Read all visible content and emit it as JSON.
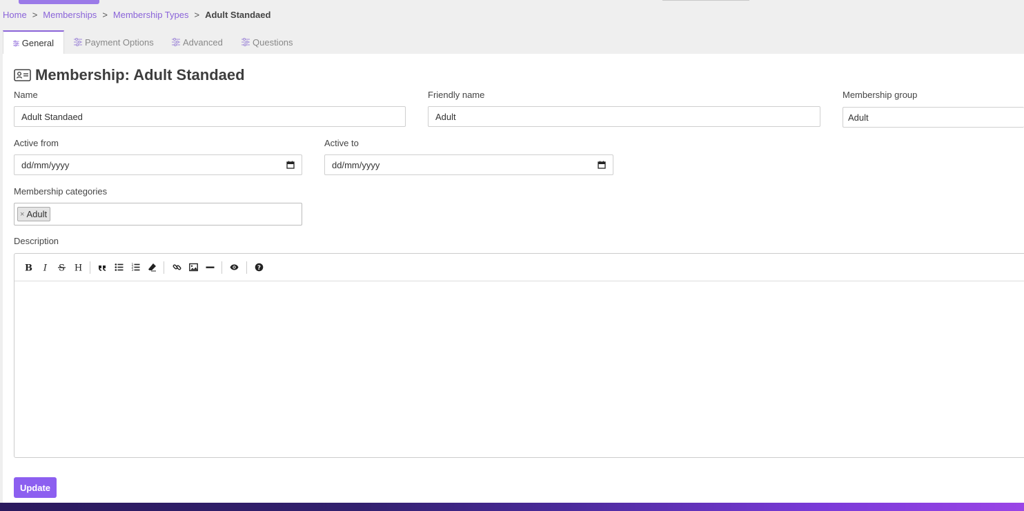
{
  "breadcrumb": {
    "items": [
      "Home",
      "Memberships",
      "Membership Types"
    ],
    "current": "Adult Standaed",
    "separator": ">"
  },
  "tabs": [
    {
      "label": "General",
      "icon": "sliders-icon",
      "active": true
    },
    {
      "label": "Payment Options",
      "icon": "sliders-icon",
      "active": false
    },
    {
      "label": "Advanced",
      "icon": "sliders-icon",
      "active": false
    },
    {
      "label": "Questions",
      "icon": "sliders-icon",
      "active": false
    }
  ],
  "page": {
    "title": "Membership: Adult Standaed",
    "title_icon": "id-card-icon"
  },
  "form": {
    "name": {
      "label": "Name",
      "value": "Adult Standaed"
    },
    "friendly_name": {
      "label": "Friendly name",
      "value": "Adult"
    },
    "membership_group": {
      "label": "Membership group",
      "value": "Adult"
    },
    "active_from": {
      "label": "Active from",
      "value": "dd/mm/yyyy"
    },
    "active_to": {
      "label": "Active to",
      "value": "dd/mm/yyyy"
    },
    "categories": {
      "label": "Membership categories",
      "tags": [
        "Adult"
      ],
      "remove_symbol": "×"
    },
    "description": {
      "label": "Description",
      "value": ""
    }
  },
  "editor_toolbar": [
    "bold",
    "italic",
    "strikethrough",
    "heading",
    "quote",
    "unordered-list",
    "ordered-list",
    "clean-block",
    "link",
    "image",
    "horizontal-rule",
    "preview",
    "guide"
  ],
  "actions": {
    "update_label": "Update"
  },
  "colors": {
    "accent": "#8a63d9",
    "button": "#8c5ff0"
  }
}
